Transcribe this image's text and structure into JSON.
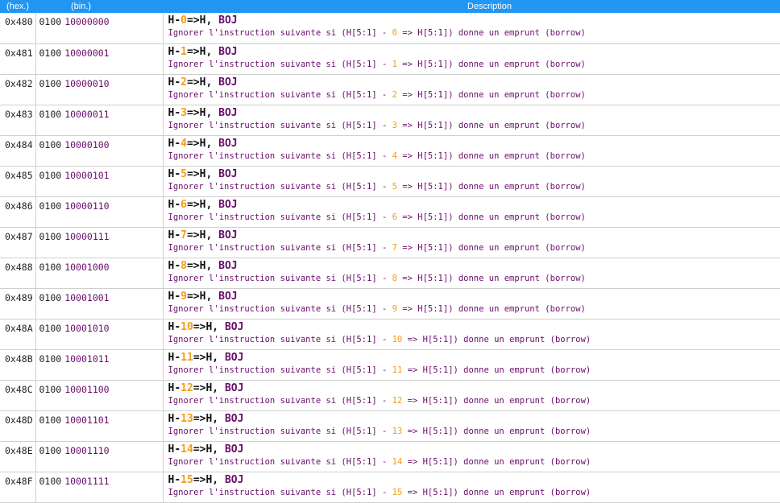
{
  "header": {
    "hex_label": "(hex.)",
    "bin_label": "(bin.)",
    "desc_label": "Description"
  },
  "colors": {
    "header_bg": "#2196f3",
    "number": "#f39c12",
    "keyword": "#6a0d6a"
  },
  "rows": [
    {
      "hex": "0x480",
      "op": "0100",
      "bits": "10000000",
      "n": "0"
    },
    {
      "hex": "0x481",
      "op": "0100",
      "bits": "10000001",
      "n": "1"
    },
    {
      "hex": "0x482",
      "op": "0100",
      "bits": "10000010",
      "n": "2"
    },
    {
      "hex": "0x483",
      "op": "0100",
      "bits": "10000011",
      "n": "3"
    },
    {
      "hex": "0x484",
      "op": "0100",
      "bits": "10000100",
      "n": "4"
    },
    {
      "hex": "0x485",
      "op": "0100",
      "bits": "10000101",
      "n": "5"
    },
    {
      "hex": "0x486",
      "op": "0100",
      "bits": "10000110",
      "n": "6"
    },
    {
      "hex": "0x487",
      "op": "0100",
      "bits": "10000111",
      "n": "7"
    },
    {
      "hex": "0x488",
      "op": "0100",
      "bits": "10001000",
      "n": "8"
    },
    {
      "hex": "0x489",
      "op": "0100",
      "bits": "10001001",
      "n": "9"
    },
    {
      "hex": "0x48A",
      "op": "0100",
      "bits": "10001010",
      "n": "10"
    },
    {
      "hex": "0x48B",
      "op": "0100",
      "bits": "10001011",
      "n": "11"
    },
    {
      "hex": "0x48C",
      "op": "0100",
      "bits": "10001100",
      "n": "12"
    },
    {
      "hex": "0x48D",
      "op": "0100",
      "bits": "10001101",
      "n": "13"
    },
    {
      "hex": "0x48E",
      "op": "0100",
      "bits": "10001110",
      "n": "14"
    },
    {
      "hex": "0x48F",
      "op": "0100",
      "bits": "10001111",
      "n": "15"
    }
  ],
  "text": {
    "mnem_prefix": "H-",
    "mnem_suffix": "=>H, ",
    "mnem_kw": "BOJ",
    "desc_prefix": "Ignorer l'instruction suivante si (H[5:1] - ",
    "desc_suffix": " => H[5:1]) donne un emprunt (borrow)"
  }
}
